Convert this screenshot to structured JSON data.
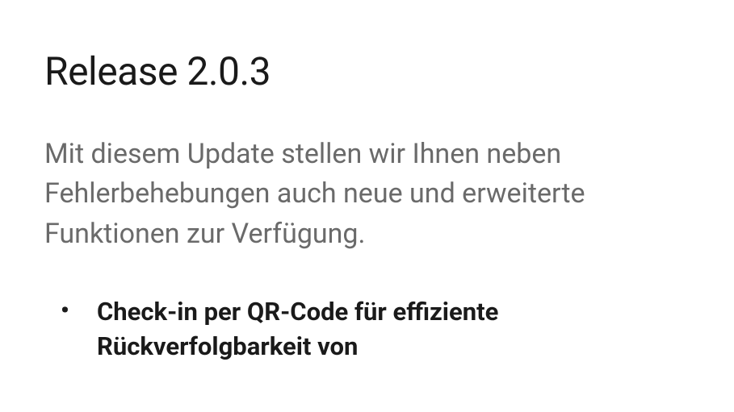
{
  "heading": "Release 2.0.3",
  "description": "Mit diesem Update stellen wir Ihnen neben Fehlerbehebungen auch neue und erweiterte Funktionen zur Verfügung.",
  "bullets": {
    "item1": "Check-in per QR-Code für effiziente Rückverfolgbarkeit von"
  }
}
